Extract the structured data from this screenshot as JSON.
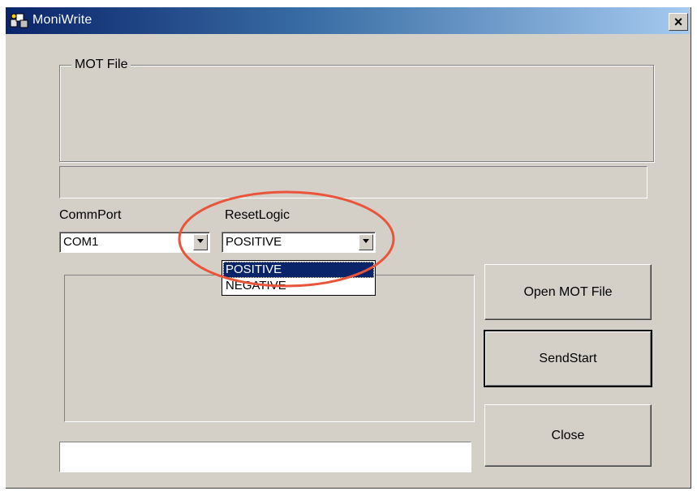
{
  "window": {
    "title": "MoniWrite",
    "close_glyph": "×"
  },
  "mot_group": {
    "label": "MOT File",
    "file_path": ""
  },
  "comm_port": {
    "label": "CommPort",
    "selected": "COM1"
  },
  "reset_logic": {
    "label": "ResetLogic",
    "selected": "POSITIVE",
    "options": [
      "POSITIVE",
      "NEGATIVE"
    ],
    "highlighted_option": "POSITIVE"
  },
  "buttons": {
    "open_mot": "Open MOT File",
    "send_start": "SendStart",
    "close": "Close"
  },
  "status_bar": {
    "text": ""
  },
  "annotation": {
    "highlight_color": "#e8553a"
  },
  "icons": {
    "app": "app-icon",
    "dropdown": "chevron-down-icon",
    "close": "close-icon"
  }
}
